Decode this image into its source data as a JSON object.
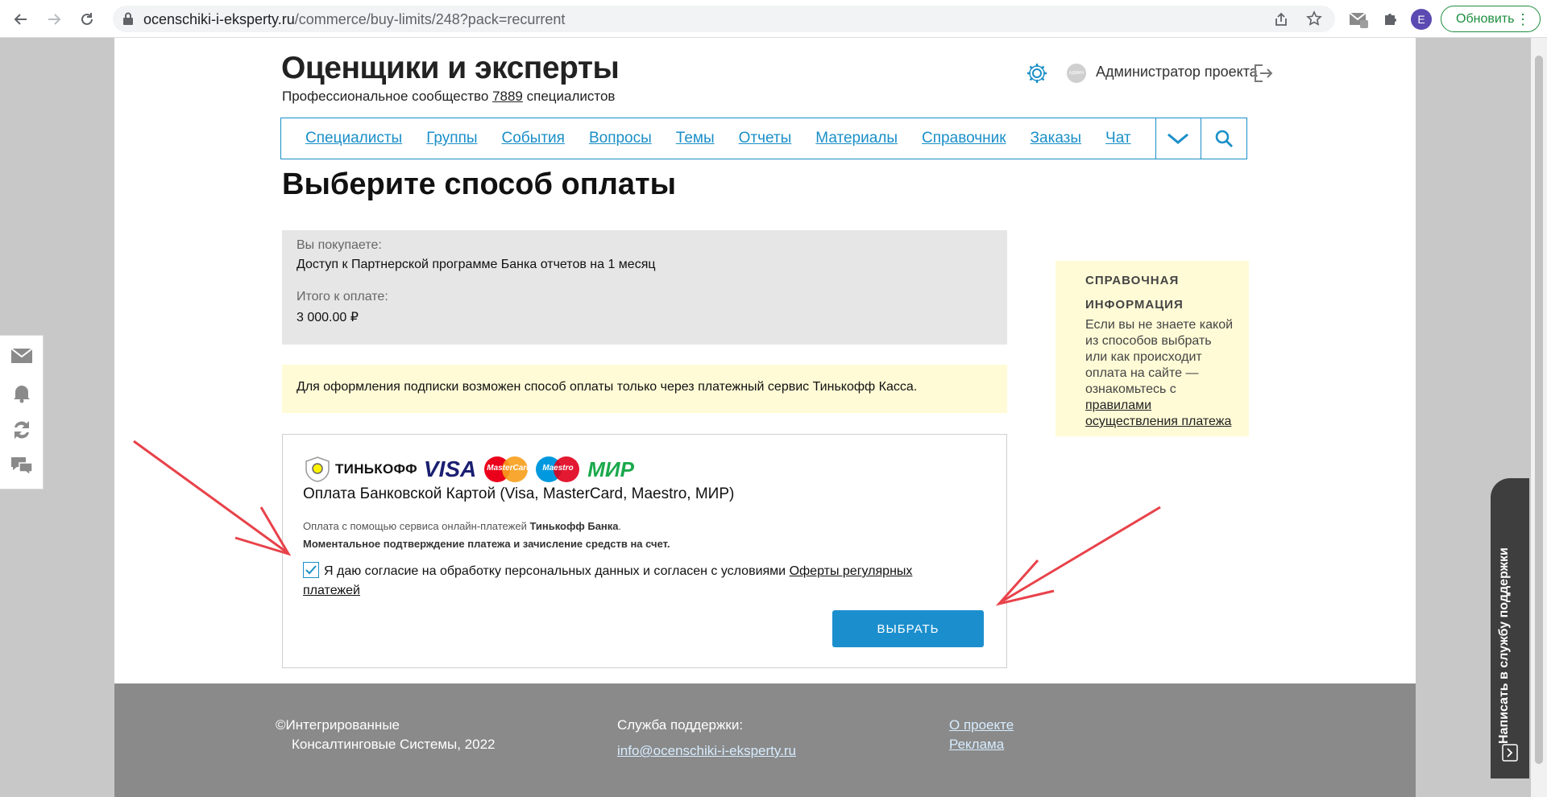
{
  "browser": {
    "url_host": "ocenschiki-i-eksperty.ru",
    "url_path": "/commerce/buy-limits/248?pack=recurrent",
    "profile_initial": "E",
    "update_label": "Обновить"
  },
  "header": {
    "brand": "Оценщики и эксперты",
    "tagline_prefix": "Профессиональное сообщество ",
    "tagline_count": "7889",
    "tagline_suffix": " специалистов",
    "admin_avatar_text": "АДМИН",
    "admin_name": "Администратор проекта"
  },
  "nav": {
    "items": [
      "Специалисты",
      "Группы",
      "События",
      "Вопросы",
      "Темы",
      "Отчеты",
      "Материалы",
      "Справочник",
      "Заказы",
      "Чат"
    ]
  },
  "page": {
    "heading": "Выберите способ оплаты"
  },
  "summary": {
    "buying_label": "Вы покупаете:",
    "buying_value": "Доступ к Партнерской программе Банка отчетов на 1 месяц",
    "total_label": "Итого к оплате:",
    "total_value": "3 000.00 ₽"
  },
  "notice": "Для оформления подписки возможен способ оплаты только через платежный сервис Тинькофф Касса.",
  "payment": {
    "logos": [
      "ТИНЬКОФФ",
      "VISA",
      "MasterCard",
      "Maestro",
      "МИР"
    ],
    "title": "Оплата Банковской Картой (Visa, MasterCard, Maestro, МИР)",
    "desc_prefix": "Оплата с помощью сервиса онлайн-платежей ",
    "desc_bank": "Тинькофф Банка",
    "desc_dot": ".",
    "desc_line2": "Моментальное подтверждение платежа и зачисление средств на счет.",
    "consent_text": "Я даю согласие на обработку персональных данных и согласен с условиями ",
    "consent_link": "Оферты регулярных платежей",
    "consent_checked": true,
    "choose_label": "ВЫБРАТЬ"
  },
  "help": {
    "title_line1": "СПРАВОЧНАЯ",
    "title_line2": "ИНФОРМАЦИЯ",
    "body": "Если вы не знаете какой из способов выбрать или как происходит оплата на сайте — ознакомьтесь с ",
    "link": "правилами осуществления платежа"
  },
  "footer": {
    "copyright_line1": "Интегрированные",
    "copyright_line2": "Консалтинговые Системы, 2022",
    "support_label": "Служба поддержки:",
    "support_email": "info@ocenschiki-i-eksperty.ru",
    "link_about": "О проекте",
    "link_ads": "Реклама"
  },
  "support_tab": "Написать в службу поддержки",
  "colors": {
    "accent": "#1a8fc8",
    "button": "#1b8fce",
    "notice_bg": "#fffbd6",
    "summary_bg": "#e6e6e6",
    "footer_bg": "#8a8a8a",
    "annotation": "#e8424a"
  }
}
